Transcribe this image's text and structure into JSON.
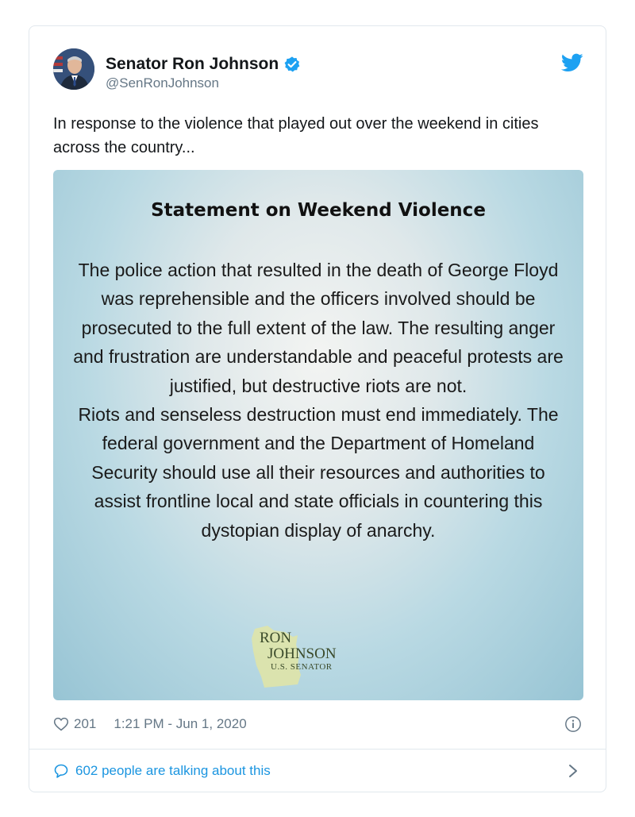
{
  "tweet": {
    "author": {
      "name": "Senator Ron Johnson",
      "handle": "@SenRonJohnson",
      "verified": true
    },
    "text": "In response to the violence that played out over the weekend in cities across the country...",
    "media": {
      "title": "Statement on Weekend Violence",
      "paragraphs": [
        "The police action that resulted in the death of George Floyd was reprehensible and the officers involved should be prosecuted to the full extent of the law. The resulting anger and frustration are understandable and peaceful protests are justified, but destructive riots are not.",
        "Riots and senseless destruction must end immediately. The federal government and the Department of Homeland Security should use all their resources and authorities to assist frontline local and state officials in countering this dystopian display of anarchy."
      ],
      "logo": {
        "line1": "RON",
        "line2": "JOHNSON",
        "line3": "U.S. SENATOR"
      }
    },
    "likes": "201",
    "timestamp": "1:21 PM - Jun 1, 2020",
    "talking": "602 people are talking about this"
  },
  "colors": {
    "accent": "#1da1f2",
    "link": "#1b95e0",
    "muted": "#657786"
  },
  "icons": [
    "verified-badge-icon",
    "twitter-bird-icon",
    "heart-icon",
    "info-icon",
    "speech-bubble-icon",
    "chevron-right-icon"
  ]
}
